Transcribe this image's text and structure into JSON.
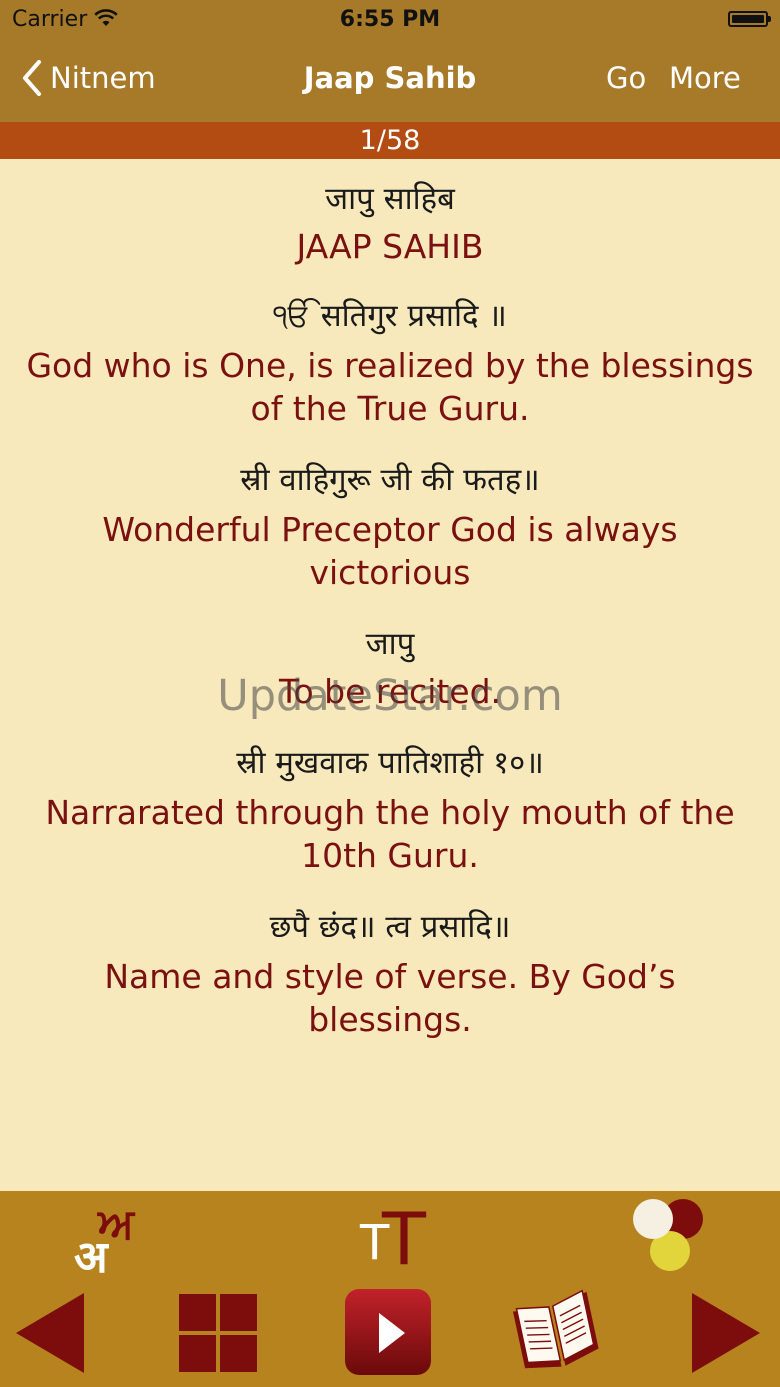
{
  "status_bar": {
    "carrier": "Carrier",
    "time": "6:55 PM"
  },
  "nav": {
    "back_label": "Nitnem",
    "title": "Jaap Sahib",
    "go_label": "Go",
    "more_label": "More"
  },
  "page_indicator": "1/58",
  "verses": [
    {
      "gurmukhi": "जापु साहिब",
      "translation": "JAAP SAHIB"
    },
    {
      "gurmukhi": "ੴ सतिगुर प्रसादि ॥",
      "translation": "God who is One, is realized by the blessings of the True Guru."
    },
    {
      "gurmukhi": "स्री वाहिगुरू जी की फतह॥",
      "translation": "Wonderful Preceptor God is always victorious"
    },
    {
      "gurmukhi": "जापु",
      "translation": "To be recited."
    },
    {
      "gurmukhi": "स्री मुखवाक पातिशाही १०॥",
      "translation": "Narrarated through the holy mouth of the 10th Guru."
    },
    {
      "gurmukhi": "छपै छंद॥ त्व प्रसादि॥",
      "translation": "Name and style of verse. By God’s blessings."
    }
  ],
  "watermark": "UpdateStar.com",
  "toolbar": {
    "script_icon": {
      "gurmukhi_char": "ਅ",
      "devanagari_char": "अ"
    },
    "text_size_icon": {
      "small": "T",
      "large": "T"
    }
  },
  "colors": {
    "nav_bg": "#a77a2a",
    "page_bar_bg": "#b24c12",
    "content_bg": "#f7e9bc",
    "translation_text": "#7a1010",
    "toolbar_bg": "#b7831f",
    "accent_dark_red": "#7d0d0d"
  }
}
